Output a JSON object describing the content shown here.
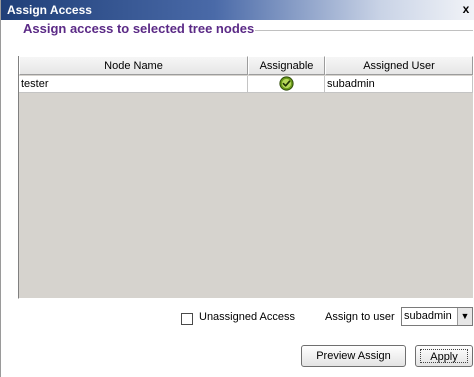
{
  "window": {
    "title": "Assign Access",
    "close_label": "x"
  },
  "group": {
    "header": "Assign access to selected tree nodes"
  },
  "table": {
    "columns": [
      "Node Name",
      "Assignable",
      "Assigned User"
    ],
    "rows": [
      {
        "node": "tester",
        "assignable": "check",
        "user": "subadmin"
      }
    ]
  },
  "controls": {
    "unassigned_label": "Unassigned Access",
    "unassigned_checked": false,
    "assign_to_label": "Assign to user",
    "assign_to_value": "subadmin"
  },
  "buttons": {
    "preview": "Preview Assign",
    "apply": "Apply"
  },
  "colors": {
    "header_text": "#5b2a86",
    "check_green": "#6a9a1b"
  }
}
